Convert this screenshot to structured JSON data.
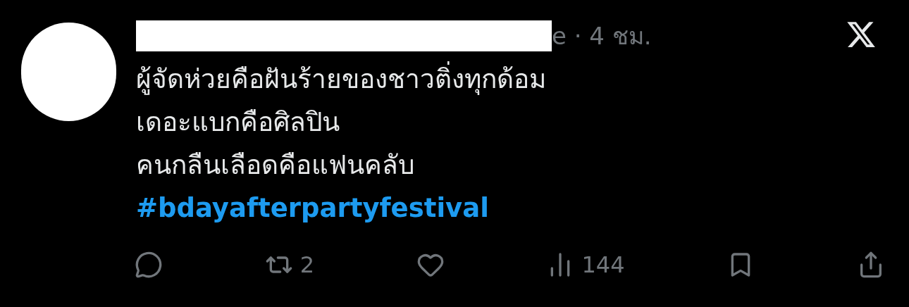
{
  "tweet": {
    "meta": "e · 4 ชม.",
    "lines": [
      "ผู้จัดห่วยคือฝันร้ายของชาวติ่งทุกด้อม",
      "เดอะแบกคือศิลปิน",
      "คนกลืนเลือดคือแฟนคลับ"
    ],
    "hashtag": "#bdayafterpartyfestival"
  },
  "actions": [
    {
      "kind": "reply"
    },
    {
      "kind": "repost",
      "count": "2"
    },
    {
      "kind": "like"
    },
    {
      "kind": "views",
      "count": "144"
    },
    {
      "kind": "bookmark"
    },
    {
      "kind": "share"
    }
  ]
}
